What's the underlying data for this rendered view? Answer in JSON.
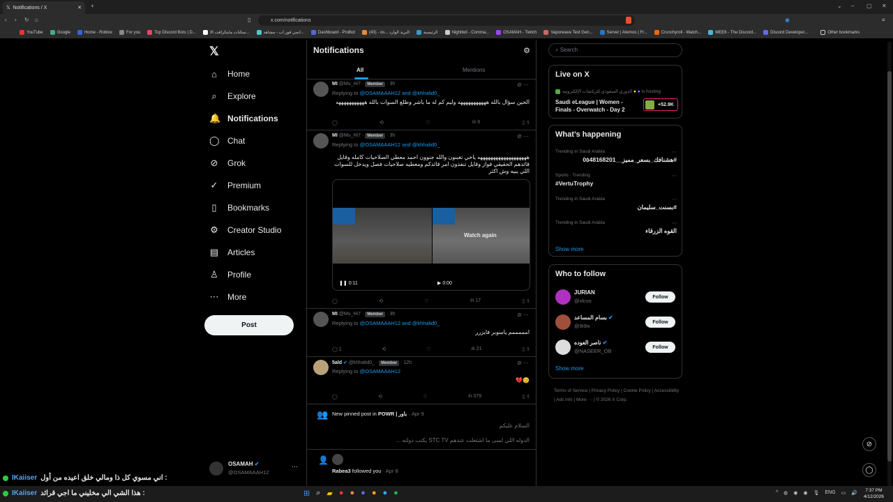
{
  "browser": {
    "tab_title": "Notifications / X",
    "url": "x.com/notifications",
    "bookmarks": [
      "YouTube",
      "Google",
      "Home - Roblox",
      "For you",
      "Top Discord Bots | D...",
      "سكنات ماينكرافت الا...",
      "انمي فور اب - مشاهد...",
      "Dashboard - ProBot",
      "(43) - os... البريد الوارد",
      "الرئيسية",
      "Nightbot - Comma...",
      "OSAMAH - Twitch",
      "Vaporwave Text Gen...",
      "Server | Aternos | Fr...",
      "Crunchyroll - Watch...",
      "MEE6 - The Discord...",
      "Discord Developer...",
      "Other bookmarks"
    ]
  },
  "nav": {
    "items": [
      {
        "icon": "⌂",
        "label": "Home"
      },
      {
        "icon": "⌕",
        "label": "Explore"
      },
      {
        "icon": "🔔",
        "label": "Notifications"
      },
      {
        "icon": "◯",
        "label": "Chat"
      },
      {
        "icon": "⊘",
        "label": "Grok"
      },
      {
        "icon": "✓",
        "label": "Premium"
      },
      {
        "icon": "▯",
        "label": "Bookmarks"
      },
      {
        "icon": "⚙",
        "label": "Creator Studio"
      },
      {
        "icon": "▤",
        "label": "Articles"
      },
      {
        "icon": "♙",
        "label": "Profile"
      },
      {
        "icon": "⋯",
        "label": "More"
      }
    ],
    "post_label": "Post",
    "account": {
      "name": "OSAMAH",
      "handle": "@OSAMAAAH12"
    }
  },
  "center": {
    "title": "Notifications",
    "tabs": [
      "All",
      "Mentions"
    ],
    "tweets": [
      {
        "name": "MI",
        "handle": "@Mu_Hi7",
        "badge": "Member",
        "time": "3h",
        "reply_prefix": "Replying to",
        "reply_to": "@OSAMAAAH12 and @khhalid0_",
        "text": "الحين سؤال بالله هههههههههههه وليم كم له ما باشر وطلع السوات بالله هههههههههههه",
        "replies": "",
        "views": "9"
      },
      {
        "name": "MI",
        "handle": "@Mu_Hi7",
        "badge": "Member",
        "time": "3h",
        "reply_prefix": "Replying to",
        "reply_to": "@OSAMAAAH12 and @khhalid0_",
        "text": "هههههههههههههههههههه ياخي تغبنون والله جنوون احمد معطي الصلاحيات كامله وقايل قائدهم الحقيقي فواز وقايل تنفذون امر قائدكم ومعطيه صلاحيات فصل ويدخل للسوات اللي يبيه وش اكثر",
        "replies": "",
        "views": "17",
        "video": {
          "time_a": "0:11",
          "time_b": "0:00",
          "overlay": "Watch again"
        }
      },
      {
        "name": "MI",
        "handle": "@Mu_Hi7",
        "badge": "Member",
        "time": "3h",
        "reply_prefix": "Replying to",
        "reply_to": "@OSAMAAAH12 and @khhalid0_",
        "text": "امممممم ياسوبر فايزرر",
        "replies": "1",
        "views": "21"
      },
      {
        "name": "5ald",
        "handle": "@khhalid0_",
        "badge": "Member",
        "time": "12h",
        "reply_prefix": "Replying to",
        "reply_to": "@OSAMAAAH12",
        "text": "😊💔",
        "replies": "",
        "views": "379"
      }
    ],
    "pinned": {
      "label": "New pinned post in",
      "community": "POWR | باور",
      "time": "Apr 9",
      "line1": "السلام عليكم",
      "line2": "الدوله اللي لسى ما اشتغلت عندهم STC TV يكتب دولته ..."
    },
    "followed": {
      "name": "Rabea3",
      "text": "followed you",
      "time": "Apr 8"
    }
  },
  "right": {
    "search_placeholder": "Search",
    "live": {
      "title": "Live on X",
      "host": "الدوري السعودي للرياضات الإلكترونية",
      "hosting": "is hosting",
      "stream": "Saudi eLeague | Women - Finals - Overwatch - Day 2",
      "viewers": "+52.9K"
    },
    "happening": {
      "title": "What’s happening",
      "items": [
        {
          "context": "Trending in Saudi Arabia",
          "topic": "#هشنافك_بسعر_مميز__0٥48168201"
        },
        {
          "context": "Sports · Trending",
          "topic": "#VertuTrophy"
        },
        {
          "context": "Trending in Saudi Arabia",
          "topic": "#بسنت_سليمان"
        },
        {
          "context": "Trending in Saudi Arabia",
          "topic": "القوه الزرقاء"
        }
      ],
      "show_more": "Show more"
    },
    "follow": {
      "title": "Who to follow",
      "users": [
        {
          "name": "JURIAN",
          "handle": "@xlcvo",
          "verified": false,
          "color": "#b030c0"
        },
        {
          "name": "بسام المساعد",
          "handle": "@9i9ix",
          "verified": true,
          "color": "#a0503a"
        },
        {
          "name": "ناصر العوده",
          "handle": "@NASEER_OB",
          "verified": true,
          "color": "#ddd"
        }
      ],
      "button": "Follow",
      "show_more": "Show more"
    },
    "footer": [
      "Terms of Service",
      "Privacy Policy",
      "Cookie Policy",
      "Accessibility",
      "Ads info",
      "More ···",
      "© 2026 X Corp."
    ]
  },
  "overlay_chat": [
    {
      "user": "IKaiiser",
      "text": ": اني مسوي كل ذا ومالي خلق اعيده من أول"
    },
    {
      "user": "IKaiiser",
      "text": ": هذا الشي الي مخليني ما اجي قرائد"
    }
  ],
  "taskbar": {
    "lang": "ENG",
    "time": "7:37 PM",
    "date": "4/12/2026"
  },
  "colors": {
    "accent": "#1d9bf0",
    "bg": "#000000"
  }
}
